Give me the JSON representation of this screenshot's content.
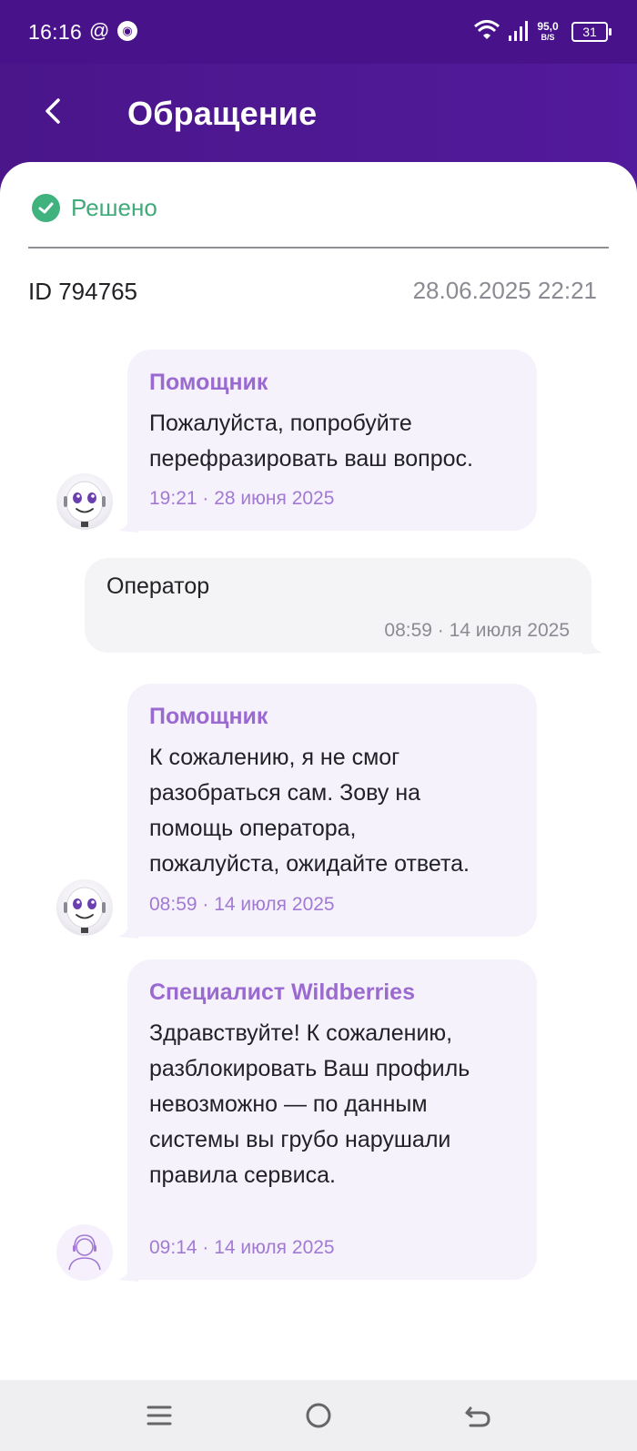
{
  "status_bar": {
    "time": "16:16",
    "at_symbol": "@",
    "speed_value": "95,0",
    "speed_unit": "B/S",
    "battery": "31"
  },
  "header": {
    "title": "Обращение"
  },
  "ticket": {
    "status": "Решено",
    "id": "ID 794765",
    "created": "28.06.2025 22:21"
  },
  "messages": [
    {
      "author": "Помощник",
      "lines": [
        "Пожалуйста, попробуйте",
        "перефразировать ваш вопрос."
      ],
      "time": "19:21 · 28 июня 2025"
    },
    {
      "text": "Оператор",
      "time": "08:59 · 14 июля 2025"
    },
    {
      "author": "Помощник",
      "lines": [
        "К сожалению, я не смог",
        "разобраться сам. Зову на",
        "помощь оператора,",
        "пожалуйста, ожидайте ответа."
      ],
      "time": "08:59 · 14 июля 2025"
    },
    {
      "author": "Специалист Wildberries",
      "lines": [
        "Здравствуйте! К сожалению,",
        "разблокировать Ваш профиль",
        "невозможно — по данным",
        "системы вы грубо нарушали",
        "правила сервиса."
      ],
      "time": "09:14 · 14 июля 2025"
    }
  ],
  "colors": {
    "header": "#4a168a",
    "accent": "#9a6ad0",
    "resolved": "#3fb27e"
  },
  "icons": {
    "back": "chevron-left-icon",
    "status": "check-circle-icon",
    "nav_menu": "menu-icon",
    "nav_home": "home-circle-icon",
    "nav_back": "back-arrow-icon"
  }
}
